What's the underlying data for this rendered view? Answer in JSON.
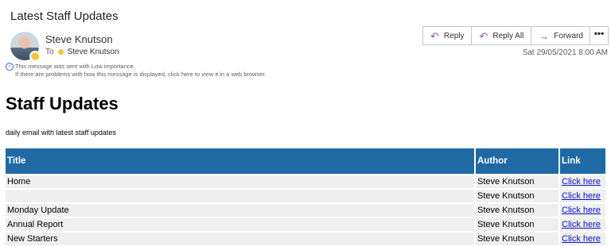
{
  "email": {
    "subject": "Latest Staff Updates",
    "sender": "Steve Knutson",
    "to_label": "To",
    "to_name": "Steve Knutson",
    "notice_line1": "This message was sent with Low importance.",
    "notice_line2": "If there are problems with how this message is displayed, click here to view it in a web browser.",
    "timestamp": "Sat 29/05/2021 8:00 AM",
    "presence_color": "#f8c43c"
  },
  "toolbar": {
    "reply_label": "Reply",
    "reply_all_label": "Reply All",
    "forward_label": "Forward",
    "more_label": "•••",
    "reply_icon": "↶",
    "reply_all_icon": "↶",
    "forward_icon": "→"
  },
  "body": {
    "heading": "Staff Updates",
    "description": "daily email with latest staff updates",
    "header_color": "#1f6aa5",
    "table": {
      "headers": [
        "Title",
        "Author",
        "Link"
      ],
      "rows": [
        [
          "Home",
          "Steve Knutson",
          "Click here"
        ],
        [
          "",
          "Steve Knutson",
          "Click here"
        ],
        [
          "Monday Update",
          "Steve Knutson",
          "Click here"
        ],
        [
          "Annual Report",
          "Steve Knutson",
          "Click here"
        ],
        [
          "New Starters",
          "Steve Knutson",
          "Click here"
        ]
      ]
    }
  }
}
